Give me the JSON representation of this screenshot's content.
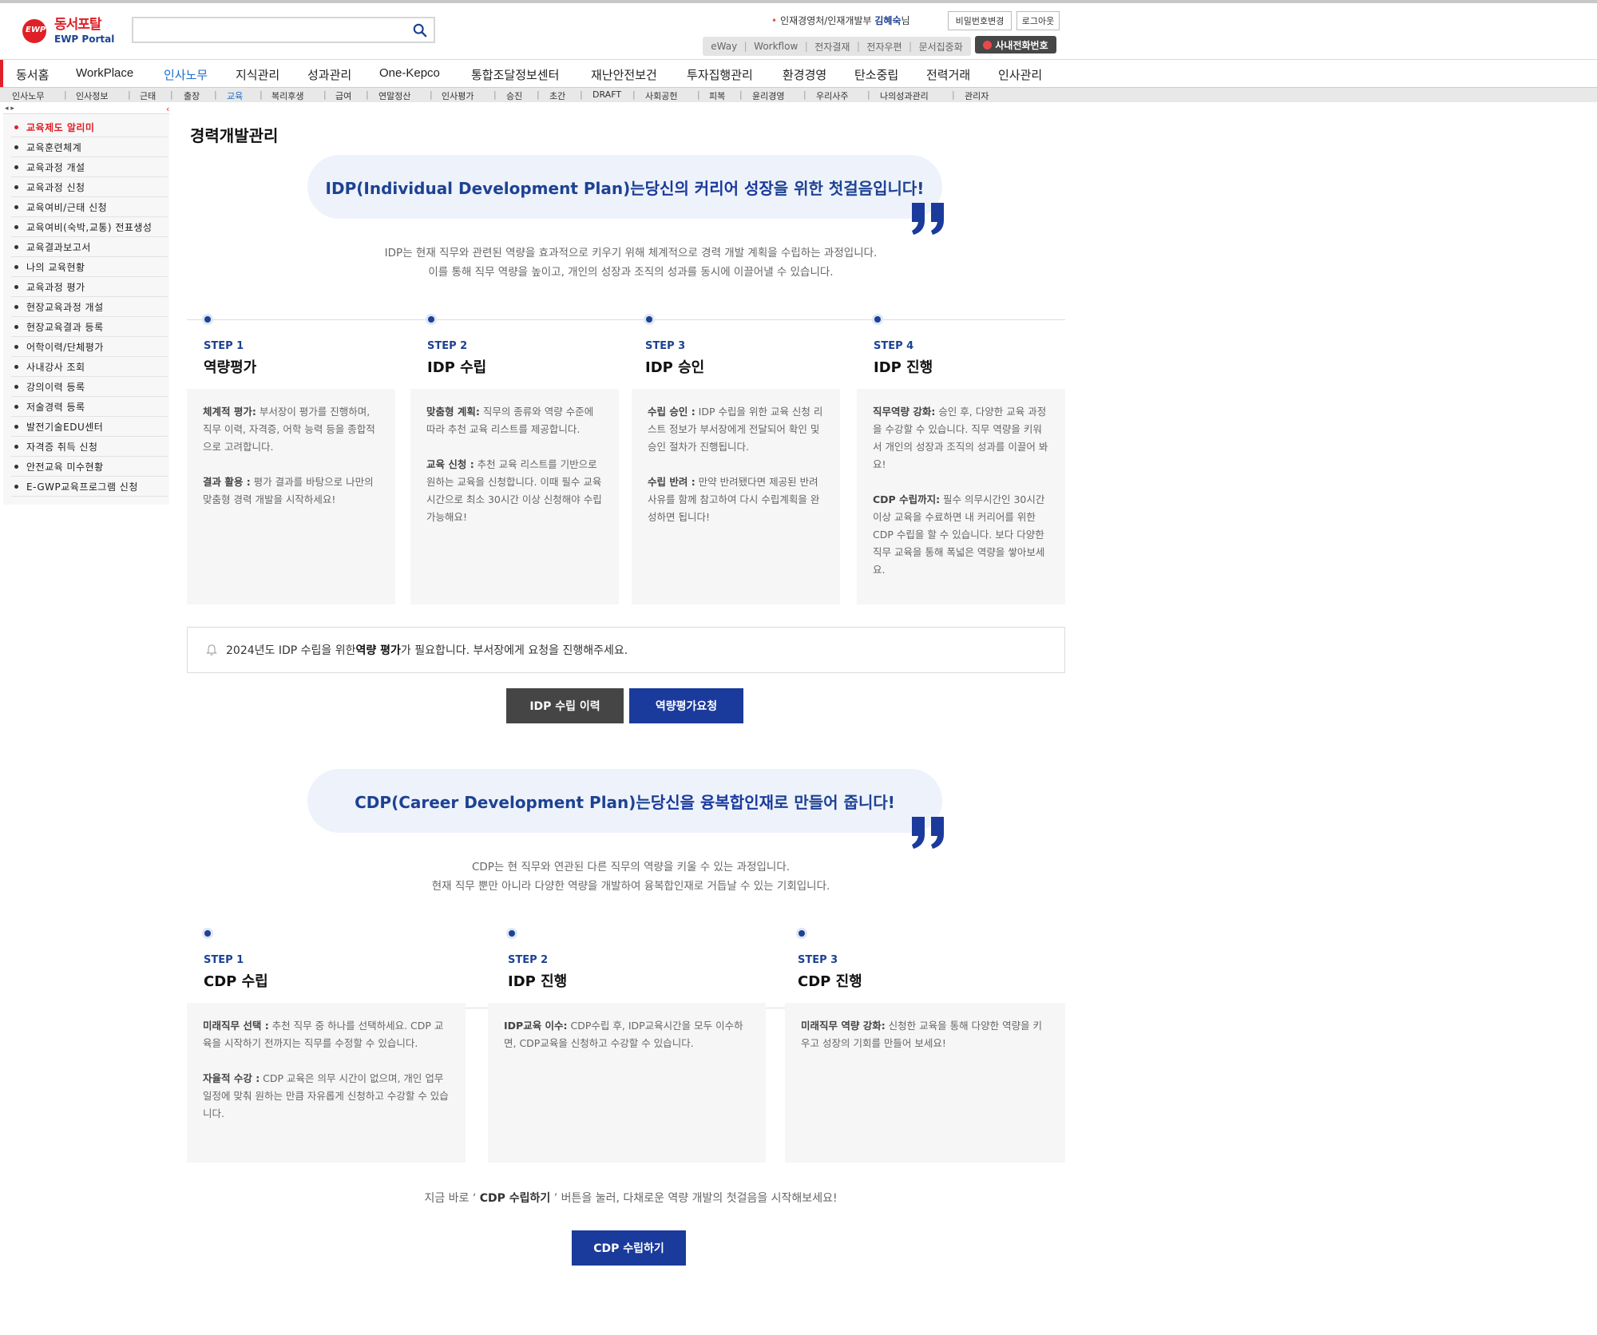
{
  "header": {
    "logo_kr": "동서포탈",
    "logo_en": "EWP Portal",
    "logo_mark": "EWP",
    "search_placeholder": "",
    "user_dept": "인재경영처/인재개발부",
    "user_name": "김혜숙",
    "user_suffix": "님",
    "change_password": "비밀번호변경",
    "logout": "로그아웃",
    "quick_links": [
      "eWay",
      "Workflow",
      "전자결재",
      "전자우편",
      "문서집중화"
    ],
    "phone_button": "사내전화번호"
  },
  "main_nav": {
    "items": [
      "동서홈",
      "WorkPlace",
      "인사노무",
      "지식관리",
      "성과관리",
      "One-Kepco",
      "통합조달정보센터",
      "재난안전보건",
      "투자집행관리",
      "환경경영",
      "탄소중립",
      "전력거래",
      "인사관리"
    ],
    "active": "인사노무"
  },
  "sub_nav": {
    "items": [
      "인사노무",
      "인사정보",
      "근태",
      "출장",
      "교육",
      "복리후생",
      "급여",
      "연말정산",
      "인사평가",
      "승진",
      "초간",
      "DRAFT",
      "사회공헌",
      "피복",
      "윤리경영",
      "우리사주",
      "나의성과관리",
      "관리자"
    ],
    "active": "교육"
  },
  "sidebar": {
    "items": [
      "교육제도 알리미",
      "교육훈련체계",
      "교육과정 개설",
      "교육과정 신청",
      "교육여비/근태 신청",
      "교육여비(숙박,교통) 전표생성",
      "교육결과보고서",
      "나의 교육현황",
      "교육과정 평가",
      "현장교육과정 개설",
      "현장교육결과 등록",
      "어학이력/단체평가",
      "사내강사 조회",
      "강의이력 등록",
      "저술경력 등록",
      "발전기술EDU센터",
      "자격증 취득 신청",
      "안전교육 미수현황",
      "E-GWP교육프로그램 신청"
    ],
    "active": "교육제도 알리미"
  },
  "page": {
    "title": "경력개발관리",
    "idp_banner_part1": "IDP(Individual Development Plan)는",
    "idp_banner_part2": "당신의 커리어 성장",
    "idp_banner_part3": "을 위한 첫걸음입니다!",
    "idp_intro_line1": "IDP는 현재 직무와 관련된 역량을 효과적으로 키우기 위해 체계적으로 경력 개발 계획을 수립하는 과정입니다.",
    "idp_intro_line2": "이를 통해 직무 역량을 높이고, 개인의 성장과 조직의 성과를 동시에 이끌어낼 수 있습니다.",
    "idp_steps": [
      {
        "num": "STEP 1",
        "title": "역량평가",
        "p1_title": "체계적 평가:",
        "p1_text": " 부서장이 평가를 진행하며, 직무 이력, 자격증, 어학 능력 등을 종합적으로 고려합니다.",
        "p2_title": "결과 활용 :",
        "p2_text": " 평가 결과를 바탕으로 나만의 맞춤형 경력 개발을 시작하세요!"
      },
      {
        "num": "STEP 2",
        "title": "IDP 수립",
        "p1_title": "맞춤형 계획:",
        "p1_text": " 직무의 종류와 역량 수준에 따라 추천 교육 리스트를 제공합니다.",
        "p2_title": "교육 신청 :",
        "p2_text": " 추천 교육 리스트를 기반으로 원하는 교육을 신청합니다. 이때 필수 교육시간으로 최소 30시간 이상 신청해야 수립 가능해요!"
      },
      {
        "num": "STEP 3",
        "title": "IDP 승인",
        "p1_title": "수립 승인 :",
        "p1_text": " IDP 수립을 위한 교육 신청 리스트 정보가 부서장에게 전달되어 확인 및 승인 절차가 진행됩니다.",
        "p2_title": "수립 반려 :",
        "p2_text": " 만약 반려됐다면 제공된 반려 사유를 함께 참고하여 다시 수립계획을 완성하면 됩니다!"
      },
      {
        "num": "STEP 4",
        "title": "IDP 진행",
        "p1_title": "직무역량 강화:",
        "p1_text": " 승인 후, 다양한 교육 과정을 수강할 수 있습니다. 직무 역량을 키워서 개인의 성장과 조직의 성과를 이끌어 봐요!",
        "p2_title": "CDP 수립까지:",
        "p2_text": " 필수 의무시간인 30시간 이상 교육을 수료하면 내 커리어를 위한 CDP 수립을 할 수 있습니다. 보다 다양한 직무 교육을 통해 폭넓은 역량을 쌓아보세요."
      }
    ],
    "notice_pre": "2024년도 IDP 수립을 위한 ",
    "notice_bold": "역량 평가",
    "notice_post": "가 필요합니다. 부서장에게 요청을 진행해주세요.",
    "btn_idp_history": "IDP 수립 이력",
    "btn_eval_request": "역량평가요청",
    "cdp_banner_part1": "CDP(Career Development Plan)는",
    "cdp_banner_part2": "당신을 융복합인재",
    "cdp_banner_part3": "로 만들어 줍니다!",
    "cdp_intro_line1": "CDP는 현 직무와 연관된 다른 직무의 역량을 키울 수 있는 과정입니다.",
    "cdp_intro_line2": "현재 직무 뿐만 아니라 다양한 역량을 개발하여 융복합인재로 거듭날 수 있는 기회입니다.",
    "cdp_steps": [
      {
        "num": "STEP 1",
        "title": "CDP 수립",
        "p1_title": "미래직무 선택 :",
        "p1_text": " 추천 직무 중 하나를 선택하세요. CDP 교육을 시작하기 전까지는 직무를 수정할 수 있습니다.",
        "p2_title": "자율적 수강 :",
        "p2_text": " CDP 교육은 의무 시간이 없으며, 개인 업무 일정에 맞춰 원하는 만큼 자유롭게 신청하고 수강할 수 있습니다."
      },
      {
        "num": "STEP 2",
        "title": "IDP 진행",
        "p1_title": "IDP교육 이수:",
        "p1_text": " CDP수립 후, IDP교육시간을 모두 이수하면, CDP교육을 신청하고 수강할 수 있습니다.",
        "p2_title": "",
        "p2_text": ""
      },
      {
        "num": "STEP 3",
        "title": "CDP 진행",
        "p1_title": "미래직무 역량 강화:",
        "p1_text": " 신청한 교육을 통해 다양한 역량을 키우고 성장의 기회를 만들어 보세요!",
        "p2_title": "",
        "p2_text": ""
      }
    ],
    "closing_pre": "지금 바로 ‘ ",
    "closing_bold": "CDP 수립하기",
    "closing_post": " ’ 버튼을 눌러, 다채로운 역량 개발의 첫걸음을 시작해보세요!",
    "btn_cdp": "CDP 수립하기"
  },
  "colors": {
    "brand_red": "#e02027",
    "brand_navy": "#1d4293",
    "button_blue": "#1a3a9c",
    "button_dark": "#454545"
  }
}
